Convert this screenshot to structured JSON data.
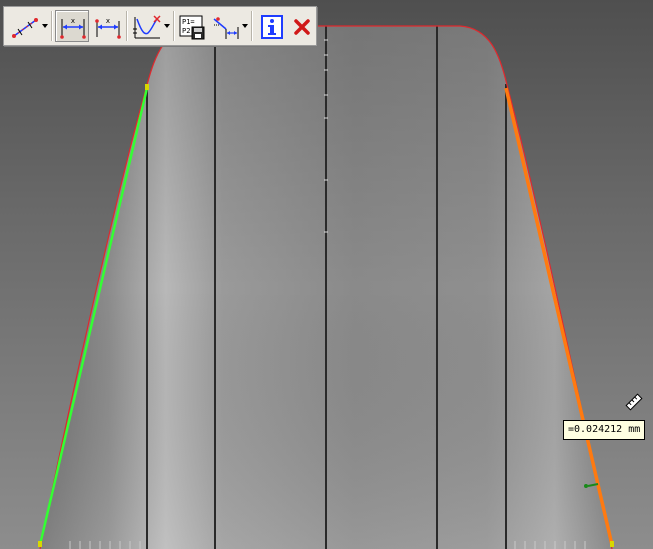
{
  "toolbar": {
    "buttons": [
      {
        "name": "measure-mode-icon",
        "has_dropdown": true
      },
      {
        "name": "horizontal-distance-icon",
        "pressed": true
      },
      {
        "name": "horizontal-distance-alt-icon"
      },
      {
        "name": "profile-fit-icon",
        "has_dropdown": true
      },
      {
        "name": "export-points-icon",
        "label": "P1= P2"
      },
      {
        "name": "angle-measure-icon",
        "has_dropdown": true
      },
      {
        "name": "info-icon",
        "label": "i"
      },
      {
        "name": "close-icon"
      }
    ]
  },
  "measurement": {
    "readout": "=0.024212 mm"
  },
  "colors": {
    "profile_line": "#e0282d",
    "left_flank": "#33ff33",
    "right_flank": "#ff7a10",
    "grid_line": "#2a2a2a",
    "background": "#5e5e5e",
    "toolbar_bg": "#ece9e2"
  }
}
